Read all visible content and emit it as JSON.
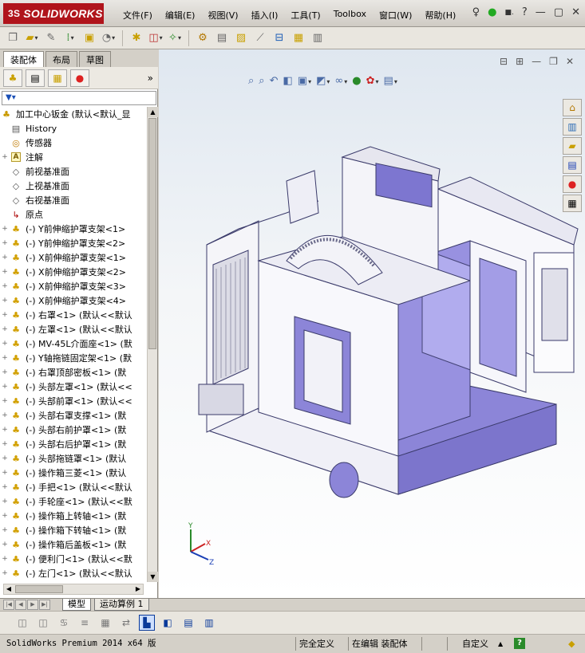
{
  "app": {
    "logo": "SOLIDWORKS",
    "logo_prefix": "3S"
  },
  "menu": [
    "文件(F)",
    "编辑(E)",
    "视图(V)",
    "插入(I)",
    "工具(T)",
    "Toolbox",
    "窗口(W)",
    "帮助(H)"
  ],
  "window_controls": {
    "search_label": "♀",
    "help": "?",
    "help_prefix": "■.",
    "minimize": "—",
    "restore": "▢",
    "close": "✕"
  },
  "left_tabs": [
    "装配体",
    "布局",
    "草图"
  ],
  "tree": {
    "root": "加工中心钣金  (默认<默认_显",
    "items": [
      {
        "label": "History",
        "icon": "history-icon",
        "exp": ""
      },
      {
        "label": "传感器",
        "icon": "sensor-icon",
        "exp": ""
      },
      {
        "label": "注解",
        "icon": "annotation-icon",
        "exp": "+"
      },
      {
        "label": "前视基准面",
        "icon": "plane-icon",
        "exp": ""
      },
      {
        "label": "上视基准面",
        "icon": "plane-icon",
        "exp": ""
      },
      {
        "label": "右视基准面",
        "icon": "plane-icon",
        "exp": ""
      },
      {
        "label": "原点",
        "icon": "origin-icon",
        "exp": ""
      },
      {
        "label": "(-) Y前伸缩护罩支架<1>",
        "icon": "part-icon",
        "exp": "+"
      },
      {
        "label": "(-) Y前伸缩护罩支架<2>",
        "icon": "part-icon",
        "exp": "+"
      },
      {
        "label": "(-) X前伸缩护罩支架<1>",
        "icon": "part-icon",
        "exp": "+"
      },
      {
        "label": "(-) X前伸缩护罩支架<2>",
        "icon": "part-icon",
        "exp": "+"
      },
      {
        "label": "(-) X前伸缩护罩支架<3>",
        "icon": "part-icon",
        "exp": "+"
      },
      {
        "label": "(-) X前伸缩护罩支架<4>",
        "icon": "part-icon",
        "exp": "+"
      },
      {
        "label": "(-) 右罩<1> (默认<<默认",
        "icon": "part-icon",
        "exp": "+"
      },
      {
        "label": "(-) 左罩<1> (默认<<默认",
        "icon": "part-icon",
        "exp": "+"
      },
      {
        "label": "(-) MV-45L介面座<1> (默",
        "icon": "part-icon",
        "exp": "+"
      },
      {
        "label": "(-) Y轴拖链固定架<1> (默",
        "icon": "part-icon",
        "exp": "+"
      },
      {
        "label": "(-) 右罩顶部密板<1> (默",
        "icon": "part-icon",
        "exp": "+"
      },
      {
        "label": "(-) 头部左罩<1> (默认<<",
        "icon": "part-icon",
        "exp": "+"
      },
      {
        "label": "(-) 头部前罩<1> (默认<<",
        "icon": "part-icon",
        "exp": "+"
      },
      {
        "label": "(-) 头部右罩支撑<1> (默",
        "icon": "part-icon",
        "exp": "+"
      },
      {
        "label": "(-) 头部右前护罩<1> (默",
        "icon": "part-icon",
        "exp": "+"
      },
      {
        "label": "(-) 头部右后护罩<1> (默",
        "icon": "part-icon",
        "exp": "+"
      },
      {
        "label": "(-) 头部拖链罩<1> (默认",
        "icon": "part-icon",
        "exp": "+"
      },
      {
        "label": "(-) 操作箱三菱<1> (默认",
        "icon": "part-icon",
        "exp": "+"
      },
      {
        "label": "(-) 手把<1> (默认<<默认",
        "icon": "part-icon",
        "exp": "+"
      },
      {
        "label": "(-) 手轮座<1> (默认<<默",
        "icon": "part-icon",
        "exp": "+"
      },
      {
        "label": "(-) 操作箱上转轴<1> (默",
        "icon": "part-icon",
        "exp": "+"
      },
      {
        "label": "(-) 操作箱下转轴<1> (默",
        "icon": "part-icon",
        "exp": "+"
      },
      {
        "label": "(-) 操作箱后盖板<1> (默",
        "icon": "part-icon",
        "exp": "+"
      },
      {
        "label": "(-) 便利门<1> (默认<<默",
        "icon": "part-icon",
        "exp": "+"
      },
      {
        "label": "(-) 左门<1> (默认<<默认",
        "icon": "part-icon",
        "exp": "+"
      }
    ]
  },
  "bottom_tabs": [
    "模型",
    "运动算例 1"
  ],
  "status": {
    "version": "SolidWorks Premium 2014 x64 版",
    "definition": "完全定义",
    "editing": "在编辑 装配体",
    "units": "自定义"
  },
  "colors": {
    "machine_body": "#f3f3f8",
    "machine_accent": "#8c85d8",
    "logo_bg": "#b0141b"
  }
}
